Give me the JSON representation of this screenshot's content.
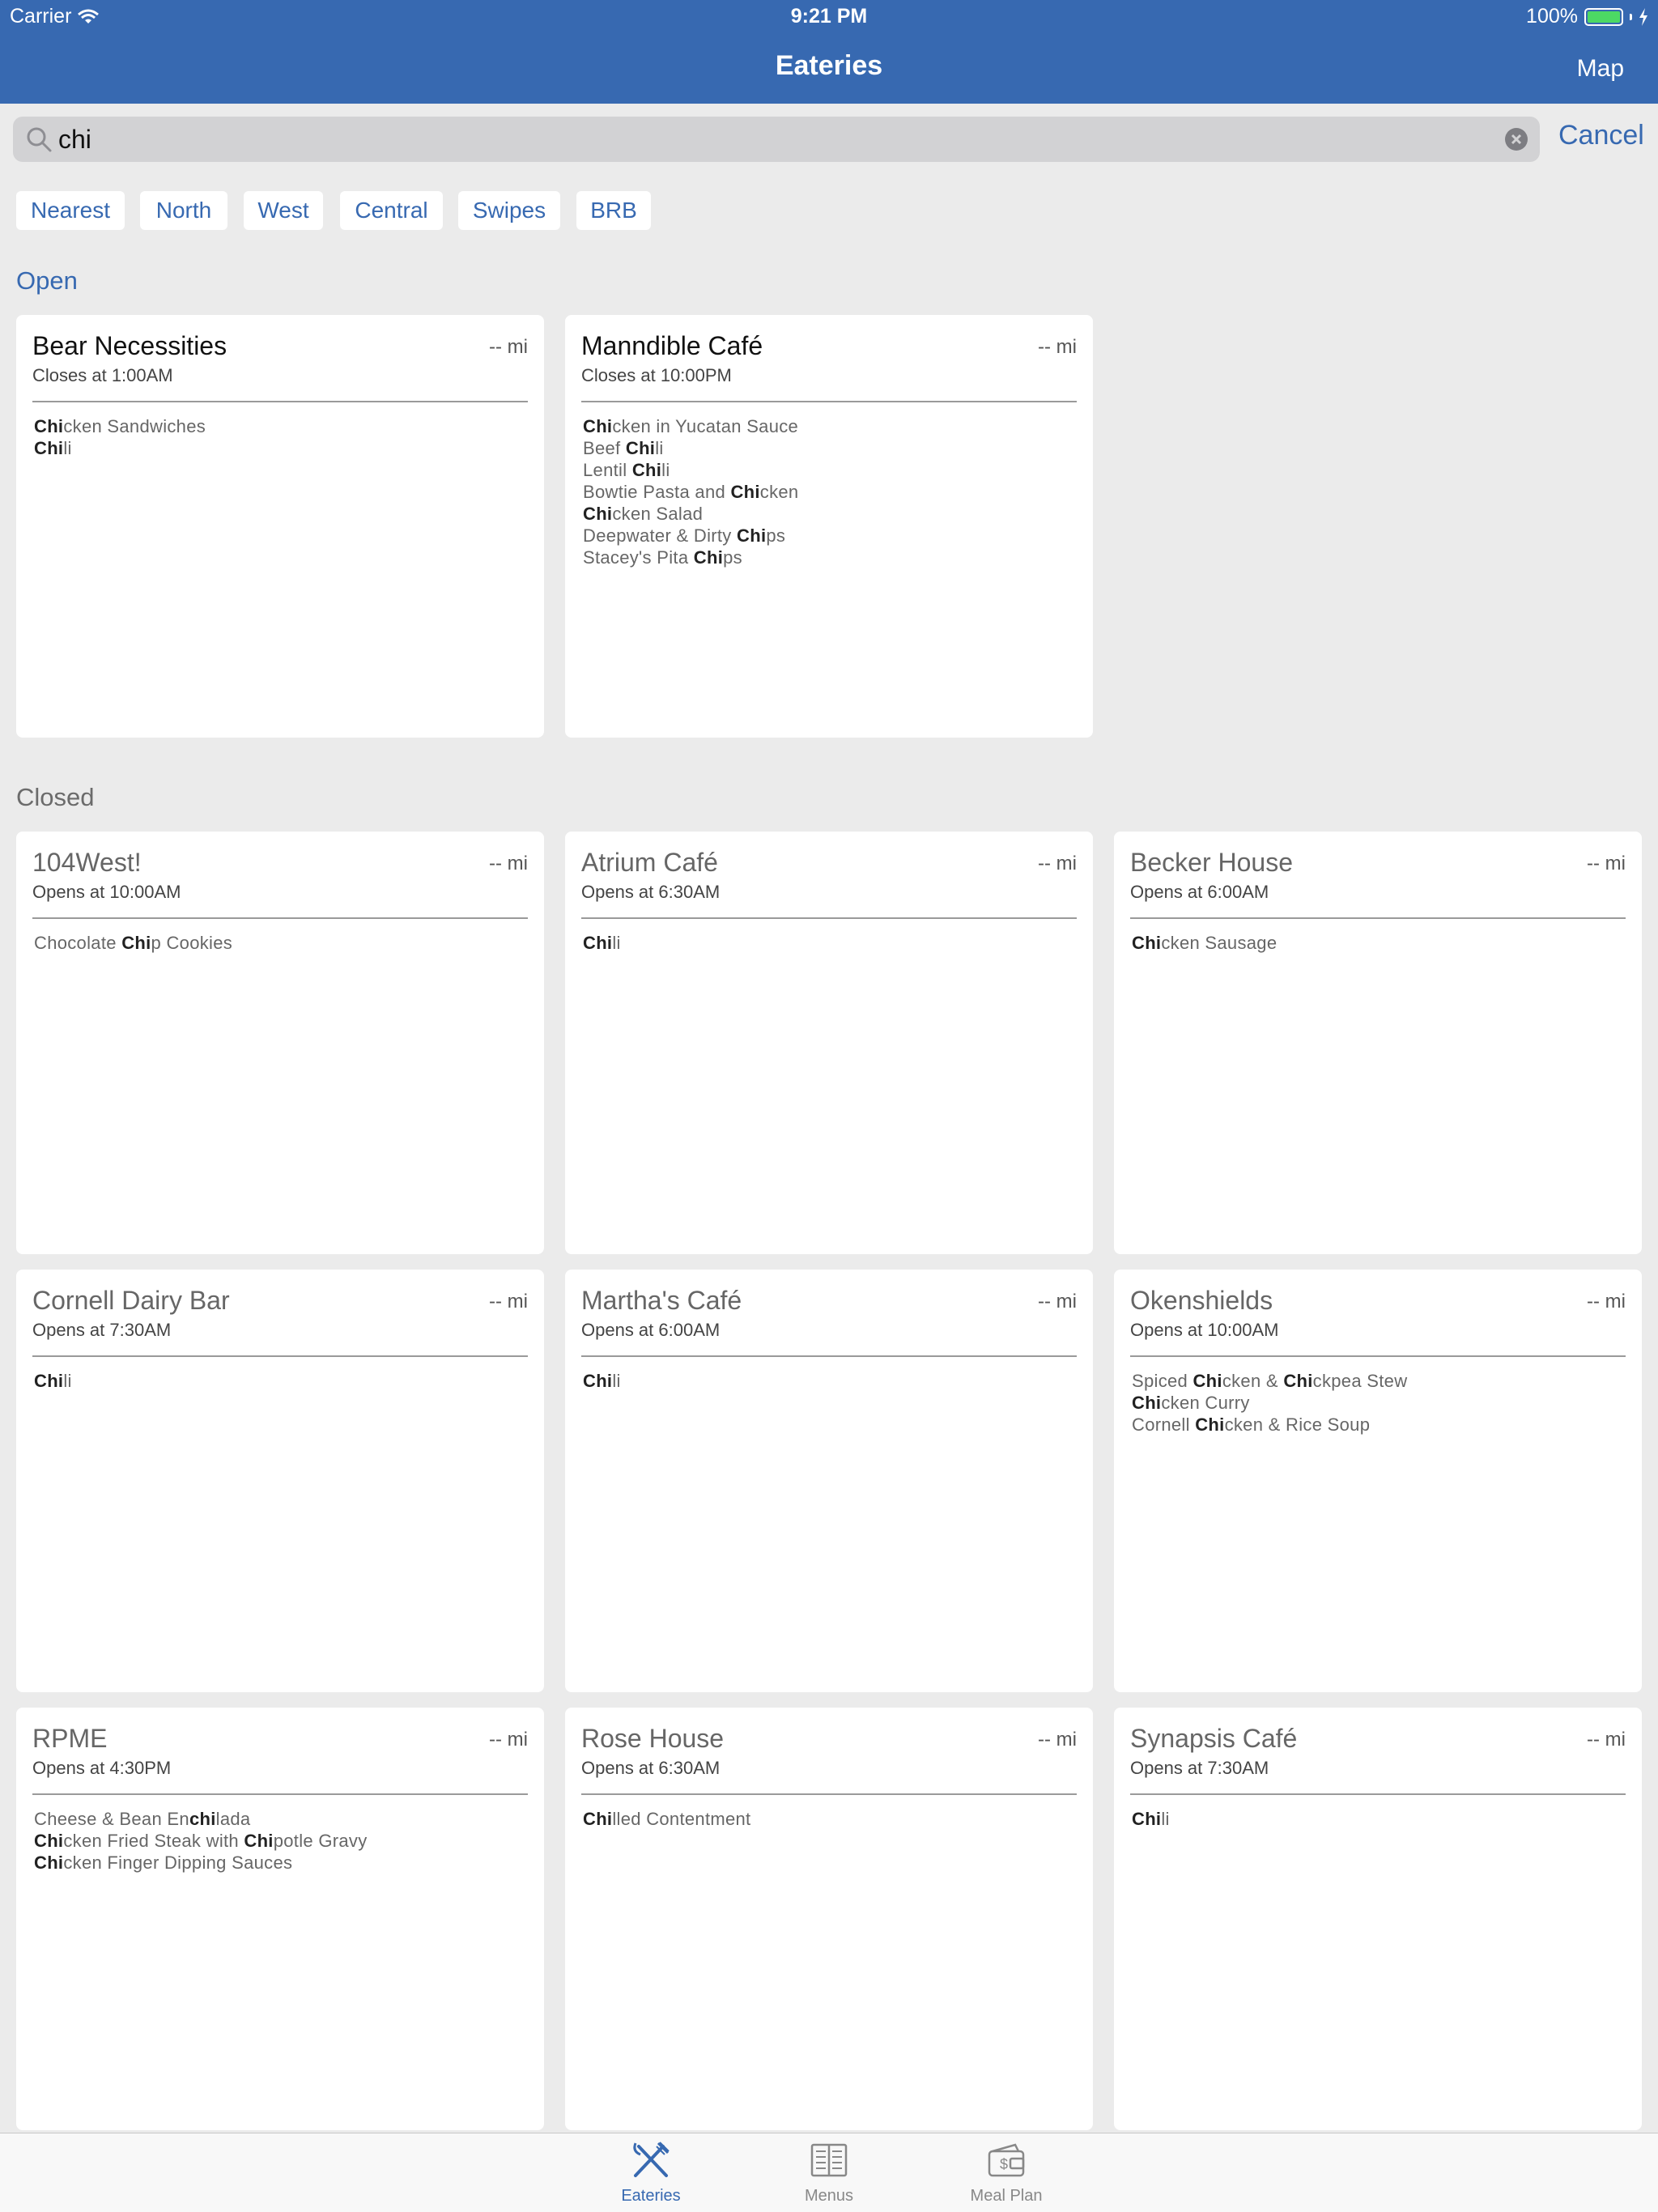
{
  "status_bar": {
    "carrier": "Carrier",
    "time": "9:21 PM",
    "battery": "100%"
  },
  "nav": {
    "title": "Eateries",
    "map_label": "Map"
  },
  "search": {
    "value": "chi",
    "cancel_label": "Cancel"
  },
  "filters": [
    "Nearest",
    "North",
    "West",
    "Central",
    "Swipes",
    "BRB"
  ],
  "sections": {
    "open": "Open",
    "closed": "Closed"
  },
  "open_eateries": [
    {
      "name": "Bear Necessities",
      "distance": "-- mi",
      "hours": "Closes at 1:00AM",
      "items": [
        [
          [
            "Chi",
            true
          ],
          [
            "cken Sandwiches",
            false
          ]
        ],
        [
          [
            "Chi",
            true
          ],
          [
            "li",
            false
          ]
        ]
      ]
    },
    {
      "name": "Manndible Café",
      "distance": "-- mi",
      "hours": "Closes at 10:00PM",
      "items": [
        [
          [
            "Chi",
            true
          ],
          [
            "cken in Yucatan Sauce",
            false
          ]
        ],
        [
          [
            "Beef ",
            false
          ],
          [
            "Chi",
            true
          ],
          [
            "li",
            false
          ]
        ],
        [
          [
            "Lentil ",
            false
          ],
          [
            "Chi",
            true
          ],
          [
            "li",
            false
          ]
        ],
        [
          [
            "Bowtie Pasta and ",
            false
          ],
          [
            "Chi",
            true
          ],
          [
            "cken",
            false
          ]
        ],
        [
          [
            "Chi",
            true
          ],
          [
            "cken Salad",
            false
          ]
        ],
        [
          [
            "Deepwater & Dirty ",
            false
          ],
          [
            "Chi",
            true
          ],
          [
            "ps",
            false
          ]
        ],
        [
          [
            "Stacey's Pita ",
            false
          ],
          [
            "Chi",
            true
          ],
          [
            "ps",
            false
          ]
        ]
      ]
    }
  ],
  "closed_eateries": [
    {
      "name": "104West!",
      "distance": "-- mi",
      "hours": "Opens at 10:00AM",
      "items": [
        [
          [
            "Chocolate ",
            false
          ],
          [
            "Chi",
            true
          ],
          [
            "p Cookies",
            false
          ]
        ]
      ]
    },
    {
      "name": "Atrium Café",
      "distance": "-- mi",
      "hours": "Opens at 6:30AM",
      "items": [
        [
          [
            "Chi",
            true
          ],
          [
            "li",
            false
          ]
        ]
      ]
    },
    {
      "name": "Becker House",
      "distance": "-- mi",
      "hours": "Opens at 6:00AM",
      "items": [
        [
          [
            "Chi",
            true
          ],
          [
            "cken Sausage",
            false
          ]
        ]
      ]
    },
    {
      "name": "Cornell Dairy Bar",
      "distance": "-- mi",
      "hours": "Opens at 7:30AM",
      "items": [
        [
          [
            "Chi",
            true
          ],
          [
            "li",
            false
          ]
        ]
      ]
    },
    {
      "name": "Martha's Café",
      "distance": "-- mi",
      "hours": "Opens at 6:00AM",
      "items": [
        [
          [
            "Chi",
            true
          ],
          [
            "li",
            false
          ]
        ]
      ]
    },
    {
      "name": "Okenshields",
      "distance": "-- mi",
      "hours": "Opens at 10:00AM",
      "items": [
        [
          [
            "Spiced ",
            false
          ],
          [
            "Chi",
            true
          ],
          [
            "cken & ",
            false
          ],
          [
            "Chi",
            true
          ],
          [
            "ckpea Stew",
            false
          ]
        ],
        [
          [
            "Chi",
            true
          ],
          [
            "cken Curry",
            false
          ]
        ],
        [
          [
            "Cornell ",
            false
          ],
          [
            "Chi",
            true
          ],
          [
            "cken & Rice Soup",
            false
          ]
        ]
      ]
    },
    {
      "name": "RPME",
      "distance": "-- mi",
      "hours": "Opens at 4:30PM",
      "items": [
        [
          [
            "Cheese & Bean En",
            false
          ],
          [
            "chi",
            true
          ],
          [
            "lada",
            false
          ]
        ],
        [
          [
            "Chi",
            true
          ],
          [
            "cken Fried Steak with ",
            false
          ],
          [
            "Chi",
            true
          ],
          [
            "potle Gravy",
            false
          ]
        ],
        [
          [
            "Chi",
            true
          ],
          [
            "cken Finger Dipping Sauces",
            false
          ]
        ]
      ]
    },
    {
      "name": "Rose House",
      "distance": "-- mi",
      "hours": "Opens at 6:30AM",
      "items": [
        [
          [
            "Chi",
            true
          ],
          [
            "lled Contentment",
            false
          ]
        ]
      ]
    },
    {
      "name": "Synapsis Café",
      "distance": "-- mi",
      "hours": "Opens at 7:30AM",
      "items": [
        [
          [
            "Chi",
            true
          ],
          [
            "li",
            false
          ]
        ]
      ]
    }
  ],
  "tabs": [
    {
      "label": "Eateries",
      "icon": "fork-knife-icon",
      "active": true
    },
    {
      "label": "Menus",
      "icon": "menu-book-icon",
      "active": false
    },
    {
      "label": "Meal Plan",
      "icon": "wallet-icon",
      "active": false
    }
  ],
  "colors": {
    "brand": "#3769b1",
    "background": "#ebebeb",
    "battery": "#4cd964"
  }
}
